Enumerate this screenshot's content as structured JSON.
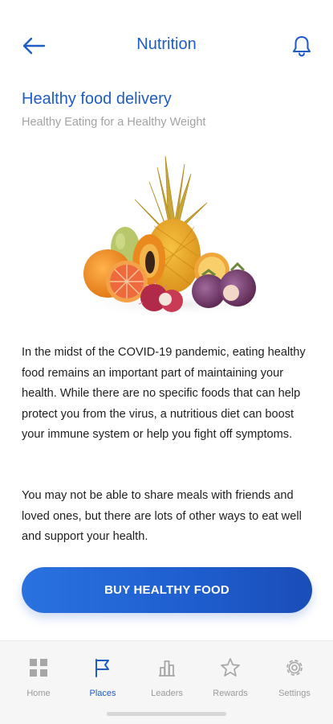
{
  "header": {
    "title": "Nutrition",
    "back_icon": "arrow-left-icon",
    "notification_icon": "bell-icon"
  },
  "article": {
    "title": "Healthy food delivery",
    "subtitle": "Healthy Eating for a Healthy Weight",
    "image": "tropical-fruits-illustration",
    "paragraphs": [
      "In the midst of the COVID-19 pandemic, eating healthy food remains an important part of maintaining your health. While there are no specific foods that can help protect you from the virus, a nutritious diet can boost your immune system or help you fight off symptoms.",
      "You may not be able to share meals with friends and loved ones, but there are lots of other ways to eat well and support your health."
    ],
    "cta_label": "BUY HEALTHY FOOD"
  },
  "nav": {
    "items": [
      {
        "label": "Home",
        "icon": "grid-icon",
        "active": false
      },
      {
        "label": "Places",
        "icon": "flag-icon",
        "active": true
      },
      {
        "label": "Leaders",
        "icon": "bar-chart-icon",
        "active": false
      },
      {
        "label": "Rewards",
        "icon": "star-icon",
        "active": false
      },
      {
        "label": "Settings",
        "icon": "gear-icon",
        "active": false
      }
    ]
  },
  "colors": {
    "accent": "#1f5cc4",
    "button_gradient_start": "#2a72e0",
    "button_gradient_end": "#1a4db8",
    "nav_inactive": "#9a9a9a",
    "nav_background": "#f6f6f6"
  }
}
